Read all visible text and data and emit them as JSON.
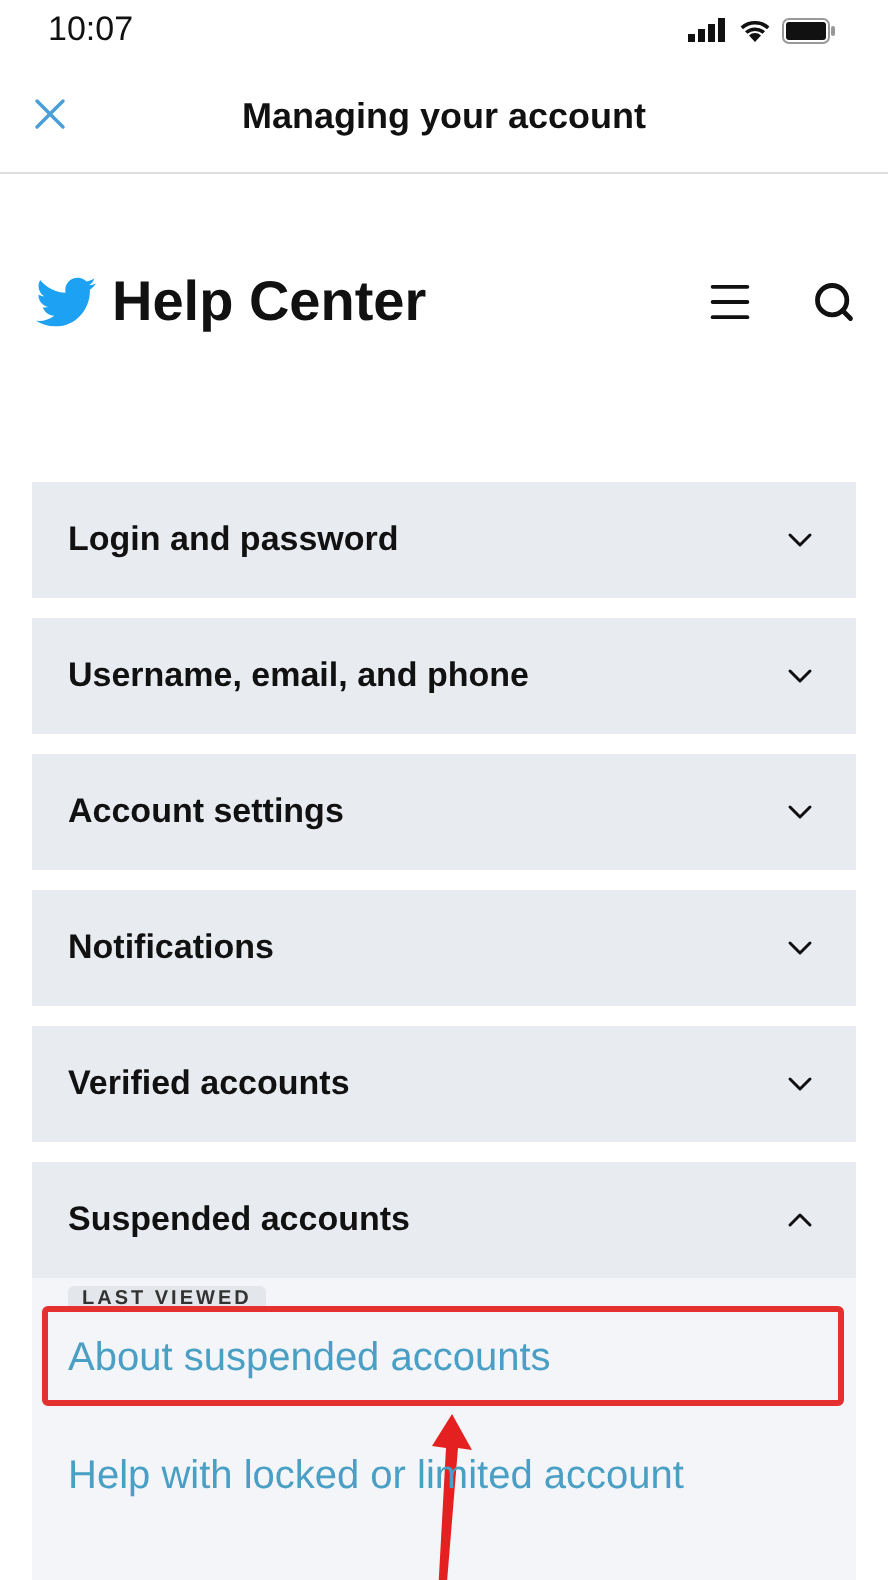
{
  "status_bar": {
    "time": "10:07"
  },
  "nav_bar": {
    "title": "Managing your account"
  },
  "header": {
    "title": "Help Center"
  },
  "sections": [
    {
      "title": "Login and password",
      "expanded": false
    },
    {
      "title": "Username, email, and phone",
      "expanded": false
    },
    {
      "title": "Account settings",
      "expanded": false
    },
    {
      "title": "Notifications",
      "expanded": false
    },
    {
      "title": "Verified accounts",
      "expanded": false
    },
    {
      "title": "Suspended accounts",
      "expanded": true,
      "links": [
        {
          "text": "About suspended accounts",
          "badge": "LAST VIEWED",
          "highlighted": true
        },
        {
          "text": "Help with locked or limited account",
          "highlighted": false
        }
      ]
    }
  ]
}
